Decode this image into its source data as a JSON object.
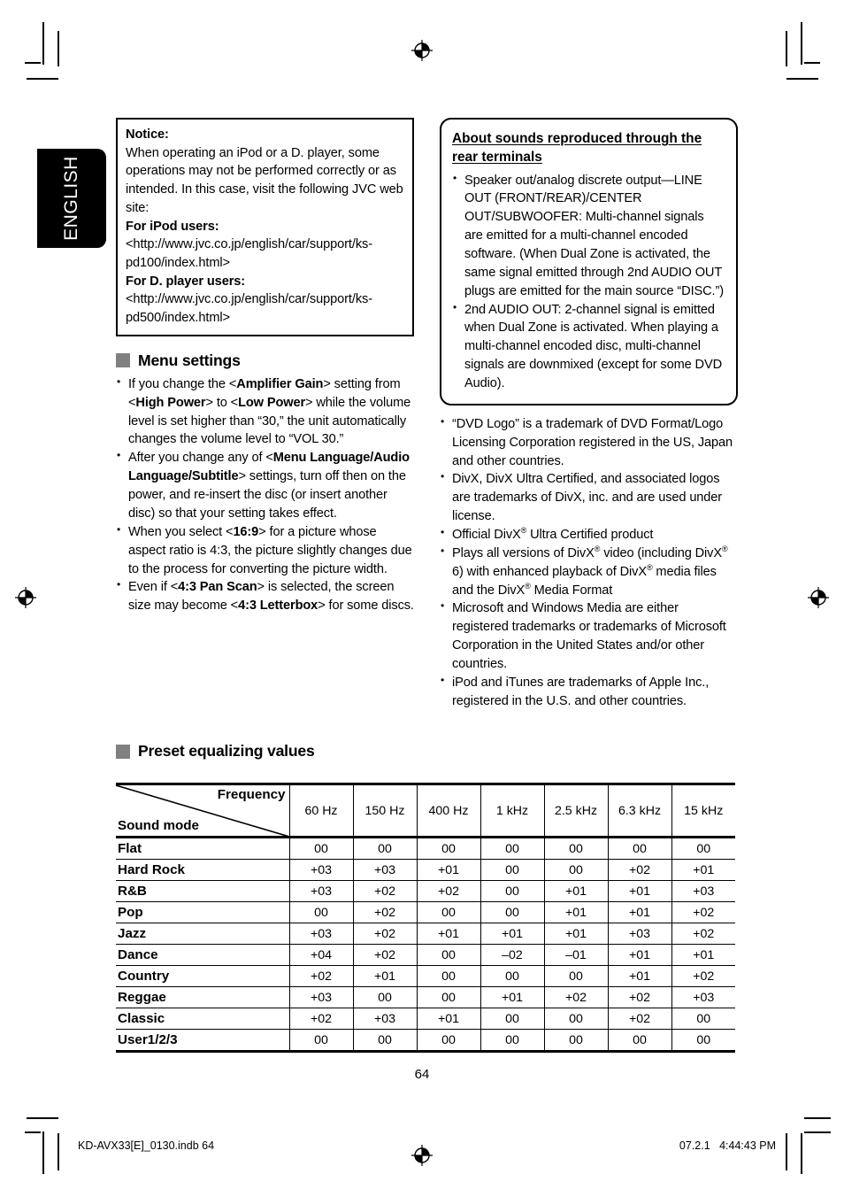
{
  "language_tab": {
    "label": "ENGLISH"
  },
  "notice_box": {
    "title": "Notice:",
    "body": "When operating an iPod or a D. player, some operations may not be performed correctly or as intended. In this case, visit the following JVC web site:",
    "ipod_label": "For iPod users:",
    "ipod_url": "<http://www.jvc.co.jp/english/car/support/ks-pd100/index.html>",
    "dplayer_label": "For D. player users:",
    "dplayer_url": "<http://www.jvc.co.jp/english/car/support/ks-pd500/index.html>"
  },
  "menu_settings": {
    "heading": "Menu settings",
    "bullets": [
      {
        "parts": [
          {
            "text": "If you change the <",
            "bold": false
          },
          {
            "text": "Amplifier Gain",
            "bold": true
          },
          {
            "text": "> setting from <",
            "bold": false
          },
          {
            "text": "High Power",
            "bold": true
          },
          {
            "text": "> to <",
            "bold": false
          },
          {
            "text": "Low Power",
            "bold": true
          },
          {
            "text": "> while the volume level is set higher than “30,” the unit automatically changes the volume level to “VOL 30.”",
            "bold": false
          }
        ]
      },
      {
        "parts": [
          {
            "text": "After you change any of <",
            "bold": false
          },
          {
            "text": "Menu Language",
            "bold": true
          },
          {
            "text": "/",
            "bold": true
          },
          {
            "text": "Audio Language",
            "bold": true
          },
          {
            "text": "/",
            "bold": true
          },
          {
            "text": "Subtitle",
            "bold": true
          },
          {
            "text": "> settings, turn off then on the power, and re-insert the disc (or insert another disc) so that your setting takes effect.",
            "bold": false
          }
        ]
      },
      {
        "parts": [
          {
            "text": "When you select <",
            "bold": false
          },
          {
            "text": "16:9",
            "bold": true
          },
          {
            "text": "> for a picture whose aspect ratio is 4:3, the picture slightly changes due to the process for converting the picture width.",
            "bold": false
          }
        ]
      },
      {
        "parts": [
          {
            "text": "Even if <",
            "bold": false
          },
          {
            "text": "4:3 Pan Scan",
            "bold": true
          },
          {
            "text": "> is selected, the screen size may become <",
            "bold": false
          },
          {
            "text": "4:3 Letterbox",
            "bold": true
          },
          {
            "text": "> for some discs.",
            "bold": false
          }
        ]
      }
    ]
  },
  "rear_terminals_box": {
    "heading": "About sounds reproduced through the rear terminals",
    "bullets": [
      "Speaker out/analog discrete output—LINE OUT (FRONT/REAR)/CENTER OUT/SUBWOOFER: Multi-channel signals are emitted for a multi-channel encoded software. (When Dual Zone is activated, the same signal emitted through 2nd AUDIO OUT plugs are emitted for the main source “DISC.”)",
      "2nd AUDIO OUT: 2-channel signal is emitted when Dual Zone is activated. When playing a multi-channel encoded disc, multi-channel signals are downmixed (except for some DVD Audio)."
    ]
  },
  "trademarks": {
    "bullets": [
      {
        "parts": [
          {
            "text": "“DVD Logo” is a trademark of DVD Format/Logo Licensing Corporation registered in the US, Japan and other countries."
          }
        ]
      },
      {
        "parts": [
          {
            "text": "DivX, DivX Ultra Certified, and associated logos are trademarks of DivX, inc. and are used under license."
          }
        ]
      },
      {
        "parts": [
          {
            "text": "Official DivX"
          },
          {
            "text": "®",
            "sup": true
          },
          {
            "text": " Ultra Certified product"
          }
        ]
      },
      {
        "parts": [
          {
            "text": "Plays all versions of DivX"
          },
          {
            "text": "®",
            "sup": true
          },
          {
            "text": " video (including DivX"
          },
          {
            "text": "®",
            "sup": true
          },
          {
            "text": " 6) with enhanced playback of DivX"
          },
          {
            "text": "®",
            "sup": true
          },
          {
            "text": " media files and the DivX"
          },
          {
            "text": "®",
            "sup": true
          },
          {
            "text": " Media Format"
          }
        ]
      },
      {
        "parts": [
          {
            "text": "Microsoft and Windows Media are either registered trademarks or trademarks of Microsoft Corporation in the United States and/or other countries."
          }
        ]
      },
      {
        "parts": [
          {
            "text": "iPod and iTunes are trademarks of Apple Inc., registered in the U.S. and other countries."
          }
        ]
      }
    ]
  },
  "preset_eq": {
    "heading": "Preset equalizing values",
    "corner_top_label": "Frequency",
    "corner_bottom_label": "Sound mode",
    "columns": [
      "60 Hz",
      "150 Hz",
      "400 Hz",
      "1 kHz",
      "2.5 kHz",
      "6.3 kHz",
      "15 kHz"
    ],
    "rows": [
      {
        "mode": "Flat",
        "values": [
          "00",
          "00",
          "00",
          "00",
          "00",
          "00",
          "00"
        ]
      },
      {
        "mode": "Hard Rock",
        "values": [
          "+03",
          "+03",
          "+01",
          "00",
          "00",
          "+02",
          "+01"
        ]
      },
      {
        "mode": "R&B",
        "values": [
          "+03",
          "+02",
          "+02",
          "00",
          "+01",
          "+01",
          "+03"
        ]
      },
      {
        "mode": "Pop",
        "values": [
          "00",
          "+02",
          "00",
          "00",
          "+01",
          "+01",
          "+02"
        ]
      },
      {
        "mode": "Jazz",
        "values": [
          "+03",
          "+02",
          "+01",
          "+01",
          "+01",
          "+03",
          "+02"
        ]
      },
      {
        "mode": "Dance",
        "values": [
          "+04",
          "+02",
          "00",
          "–02",
          "–01",
          "+01",
          "+01"
        ]
      },
      {
        "mode": "Country",
        "values": [
          "+02",
          "+01",
          "00",
          "00",
          "00",
          "+01",
          "+02"
        ]
      },
      {
        "mode": "Reggae",
        "values": [
          "+03",
          "00",
          "00",
          "+01",
          "+02",
          "+02",
          "+03"
        ]
      },
      {
        "mode": "Classic",
        "values": [
          "+02",
          "+03",
          "+01",
          "00",
          "00",
          "+02",
          "00"
        ]
      },
      {
        "mode": "User1/2/3",
        "values": [
          "00",
          "00",
          "00",
          "00",
          "00",
          "00",
          "00"
        ]
      }
    ]
  },
  "page_number": "64",
  "footer": {
    "left": "KD-AVX33[E]_0130.indb   64",
    "right": "07.2.1   4:44:43 PM"
  },
  "colors": {
    "section_square": "#808080",
    "tab_background": "#000000",
    "rule": "#000000"
  }
}
